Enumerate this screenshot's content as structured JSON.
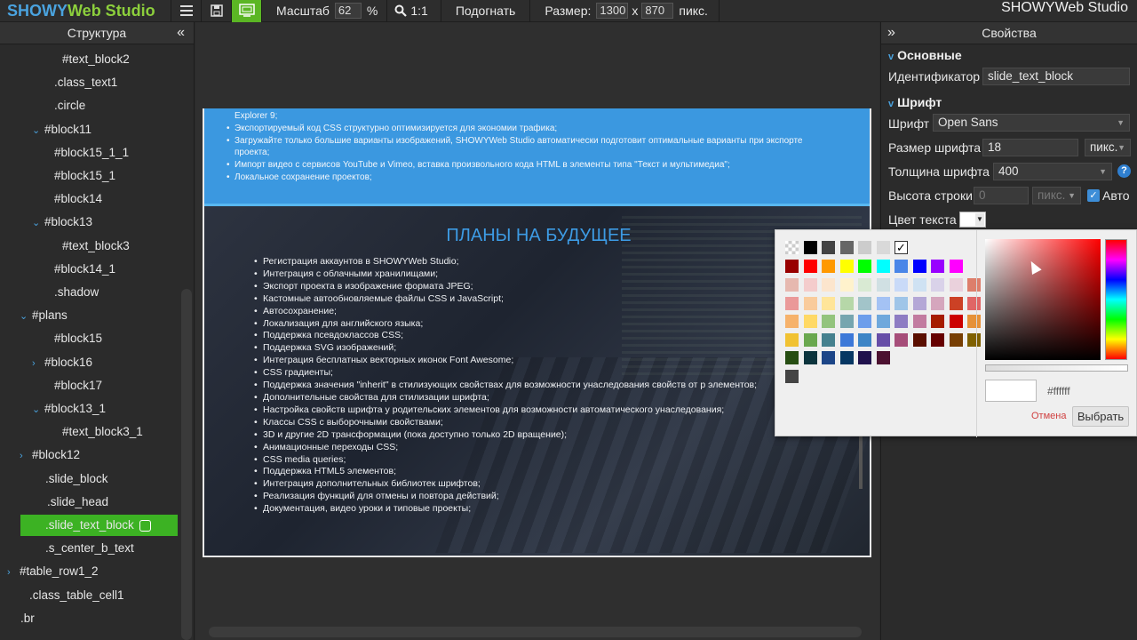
{
  "app": {
    "logo_part1": "SHOWY",
    "logo_part2": "Web Studio",
    "brand_right": "SHOWYWeb Studio"
  },
  "toolbar": {
    "menu_icon": "hamburger-icon",
    "save_icon": "save-icon",
    "preview_icon": "preview-icon",
    "scale_label": "Масштаб",
    "scale_value": "62",
    "percent": "%",
    "zoom_label": "1:1",
    "fit_label": "Подогнать",
    "size_label": "Размер:",
    "width_value": "1300",
    "x_sep": "x",
    "height_value": "870",
    "units": "пикс."
  },
  "structure": {
    "title": "Структура",
    "items": [
      {
        "label": "#text_block2",
        "arrow": ""
      },
      {
        "label": ".class_text1",
        "arrow": ""
      },
      {
        "label": ".circle",
        "arrow": ""
      },
      {
        "label": "#block11",
        "arrow": "v"
      },
      {
        "label": "#block15_1_1",
        "arrow": ""
      },
      {
        "label": "#block15_1",
        "arrow": ""
      },
      {
        "label": "#block14",
        "arrow": ""
      },
      {
        "label": "#block13",
        "arrow": "v"
      },
      {
        "label": "#text_block3",
        "arrow": ""
      },
      {
        "label": "#block14_1",
        "arrow": ""
      },
      {
        "label": ".shadow",
        "arrow": ""
      },
      {
        "label": "#plans",
        "arrow": "v"
      },
      {
        "label": "#block15",
        "arrow": ""
      },
      {
        "label": "#block16",
        "arrow": ">"
      },
      {
        "label": "#block17",
        "arrow": ""
      },
      {
        "label": "#block13_1",
        "arrow": "v"
      },
      {
        "label": "#text_block3_1",
        "arrow": ""
      },
      {
        "label": "#block12",
        "arrow": ">"
      },
      {
        "label": ".slide_block",
        "arrow": ""
      },
      {
        "label": ".slide_head",
        "arrow": ""
      },
      {
        "label": ".slide_text_block",
        "arrow": ""
      },
      {
        "label": ".s_center_b_text",
        "arrow": ""
      },
      {
        "label": "#table_row1_2",
        "arrow": ">"
      },
      {
        "label": ".class_table_cell1",
        "arrow": ""
      },
      {
        "label": ".br",
        "arrow": ""
      }
    ]
  },
  "canvas": {
    "blue_items": [
      "Explorer 9;",
      "Экспортируемый код CSS структурно оптимизируется для экономии трафика;",
      "Загружайте только большие варианты изображений, SHOWYWeb Studio автоматически подготовит оптимальные варианты при экспорте",
      "проекта;",
      "Импорт видео с сервисов YouTube и Vimeo, вставка произвольного кода HTML в элементы типа \"Текст и мультимедиа\";",
      "Локальное сохранение проектов;"
    ],
    "plans_title": "ПЛАНЫ НА БУДУЩЕЕ",
    "plans": [
      "Регистрация аккаунтов в SHOWYWeb Studio;",
      "Интеграция с облачными хранилищами;",
      "Экспорт проекта в изображение формата JPEG;",
      "Кастомные автообновляемые файлы CSS и JavaScript;",
      "Автосохранение;",
      "Локализация для английского языка;",
      "Поддержка псевдоклассов CSS;",
      "Поддержка SVG изображений;",
      "Интеграция бесплатных векторных иконок Font Awesome;",
      "CSS градиенты;",
      "Поддержка значения \"inherit\" в стилизующих свойствах для возможности унаследования свойств от р элементов;",
      "Дополнительные свойства для стилизации шрифта;",
      "Настройка свойств шрифта у родительских элементов для возможности автоматического унаследования;",
      "Классы CSS с выборочными свойствами;",
      "3D и другие 2D трансформации (пока доступно только 2D вращение);",
      "Анимационные переходы CSS;",
      "CSS media queries;",
      "Поддержка HTML5 элементов;",
      "Интеграция дополнительных библиотек шрифтов;",
      "Реализация функций для отмены и повтора действий;",
      "Документация, видео уроки и типовые проекты;"
    ]
  },
  "properties": {
    "title": "Свойства",
    "basic_title": "Основные",
    "id_label": "Идентификатор",
    "id_value": "slide_text_block",
    "font_title": "Шрифт",
    "font_label": "Шрифт",
    "font_value": "Open Sans",
    "size_label": "Размер шрифта",
    "size_value": "18",
    "size_units": "пикс.",
    "weight_label": "Толщина шрифта",
    "weight_value": "400",
    "help": "?",
    "lh_label": "Высота строки",
    "lh_value": "0",
    "lh_units": "пикс.",
    "auto_label": "Авто",
    "color_label": "Цвет текста"
  },
  "picker": {
    "hex_value": "#ffffff",
    "cancel_label": "Отмена",
    "choose_label": "Выбрать",
    "palette": [
      [
        "transparent",
        "#000000",
        "#434343",
        "#666666",
        "#cccccc",
        "#d9d9d9",
        "#ffffff"
      ],
      [
        "#980000",
        "#ff0000",
        "#ff9900",
        "#ffff00",
        "#00ff00",
        "#00ffff",
        "#4a86e8",
        "#0000ff",
        "#9900ff",
        "#ff00ff"
      ],
      [
        "#e6b8af",
        "#f4cccc",
        "#fce5cd",
        "#fff2cc",
        "#d9ead3",
        "#d0e0e3",
        "#c9daf8",
        "#cfe2f3",
        "#d9d2e9",
        "#ead1dc",
        "#dd7e6b"
      ],
      [
        "#ea9999",
        "#f9cb9c",
        "#ffe599",
        "#b6d7a8",
        "#a2c4c9",
        "#a4c2f4",
        "#9fc5e8",
        "#b4a7d6",
        "#d5a6bd",
        "#cc4125",
        "#e06666"
      ],
      [
        "#f6b26b",
        "#ffd966",
        "#93c47d",
        "#76a5af",
        "#6d9eeb",
        "#6fa8dc",
        "#8e7cc3",
        "#c27ba0",
        "#a61c00",
        "#cc0000",
        "#e69138"
      ],
      [
        "#f1c232",
        "#6aa84f",
        "#45818e",
        "#3c78d8",
        "#3d85c6",
        "#674ea7",
        "#a64d79",
        "#5b0f00",
        "#660000",
        "#783f04",
        "#7f6000"
      ],
      [
        "#274e13",
        "#0c343d",
        "#1c4587",
        "#073763",
        "#20124d",
        "#4c1130"
      ],
      [
        "#444444"
      ]
    ]
  }
}
